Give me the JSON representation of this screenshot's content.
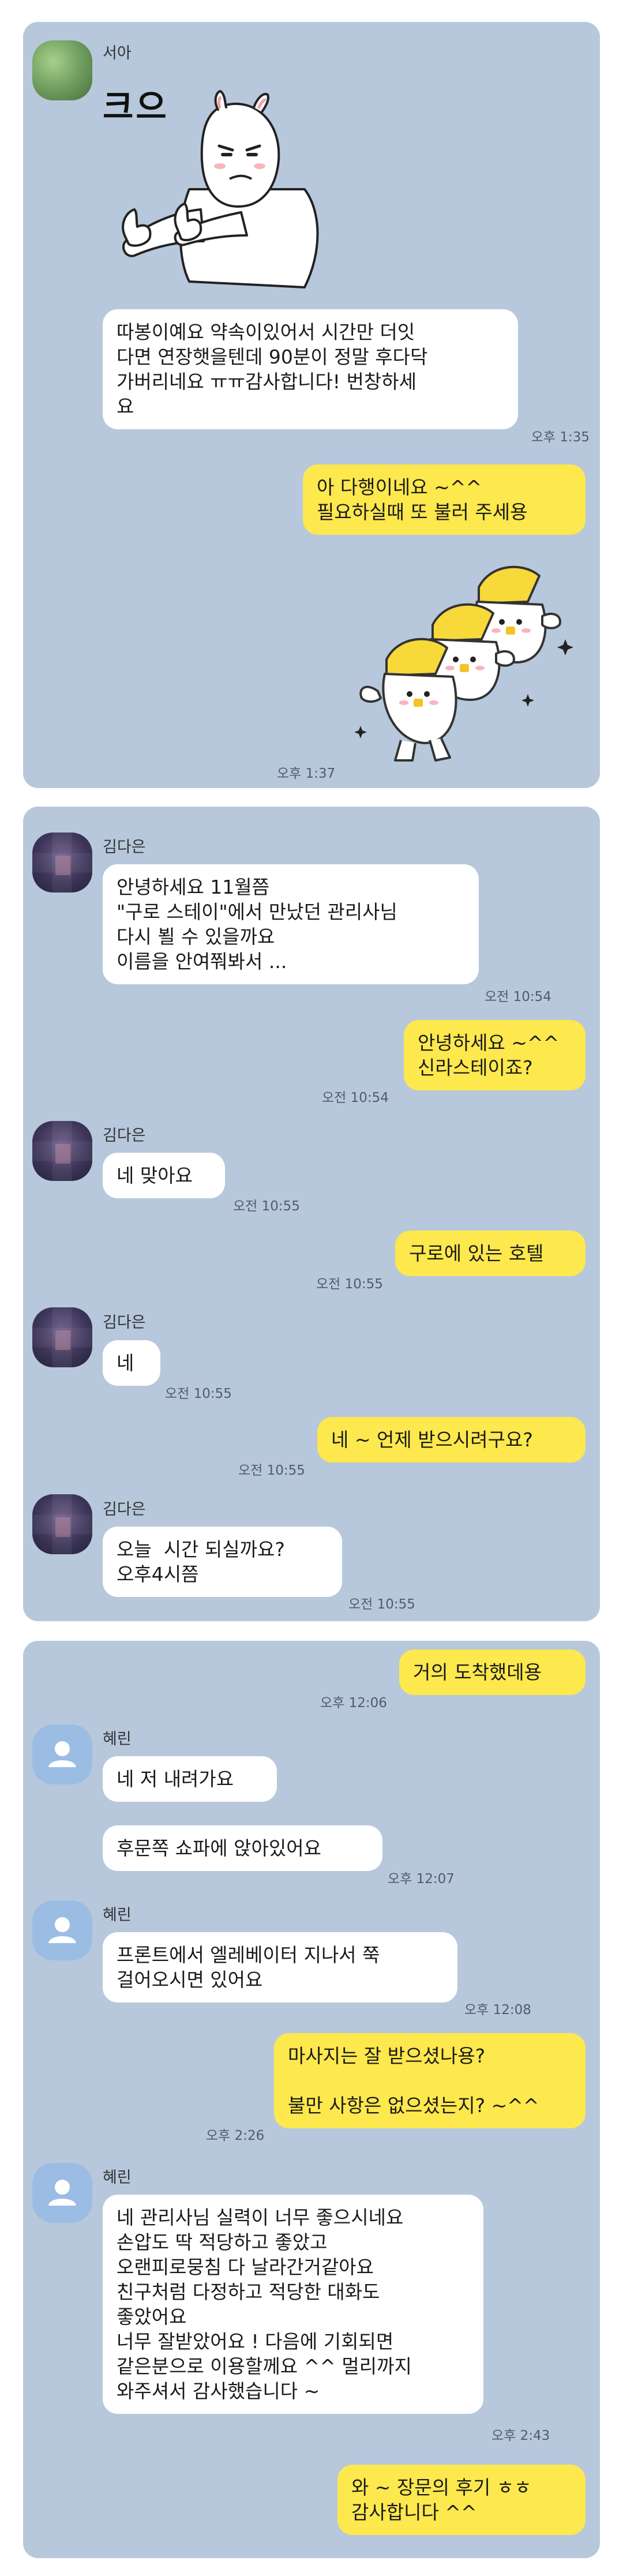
{
  "chat1": {
    "sender": "서아",
    "sticker1_text": "크으",
    "msg1": "따봉이예요 약속이있어서 시간만 더잇\n다면 연장햇을텐데 90분이 정말 후다닥\n가버리네요 ㅠㅠ감사합니다! 번창하세\n요",
    "time1": "오후 1:35",
    "reply1": "아 다행이네요 ~^^\n필요하실때 또 불러 주세용",
    "time2": "오후 1:37"
  },
  "chat2": {
    "sender": "김다은",
    "msg1": "안녕하세요 11월쯤\n\"구로 스테이\"에서 만났던 관리사님\n다시 뵐 수 있을까요\n이름을 안여쭤봐서 ...",
    "time1": "오전 10:54",
    "reply1": "안녕하세요 ~^^\n신라스테이죠?",
    "time2": "오전 10:54",
    "msg2": "네 맞아요",
    "time3": "오전 10:55",
    "reply2": "구로에 있는 호텔",
    "time4": "오전 10:55",
    "msg3": "네",
    "time5": "오전 10:55",
    "reply3": "네 ~ 언제 받으시려구요?",
    "time6": "오전 10:55",
    "msg4": "오늘  시간 되실까요?\n오후4시쯤",
    "time7": "오전 10:55"
  },
  "chat3": {
    "reply1": "거의 도착했데용",
    "time1": "오후 12:06",
    "sender": "혜린",
    "msg1": "네 저 내려가요",
    "msg2": "후문쪽 쇼파에 앉아있어요",
    "time2": "오후 12:07",
    "msg3": "프론트에서 엘레베이터 지나서 쭉\n걸어오시면 있어요",
    "time3": "오후 12:08",
    "reply2": "마사지는 잘 받으셨나용?\n\n불만 사항은 없으셨는지? ~^^",
    "time4": "오후 2:26",
    "msg4": "네 관리사님 실력이 너무 좋으시네요\n손압도 딱 적당하고 좋았고\n오랜피로뭉침 다 날라간거같아요\n친구처럼 다정하고 적당한 대화도\n좋았어요\n너무 잘받았어요 ! 다음에 기회되면\n같은분으로 이용할께요 ^^ 멀리까지\n와주셔서 감사했습니다 ~",
    "time5": "오후 2:43",
    "reply3": "와 ~ 장문의 후기 ㅎㅎ\n감사합니다 ^^"
  },
  "colors": {
    "panel_bg": "#b7c8dc",
    "incoming_bubble": "#ffffff",
    "outgoing_bubble": "#fde84d",
    "default_avatar": "#9bbde4"
  }
}
